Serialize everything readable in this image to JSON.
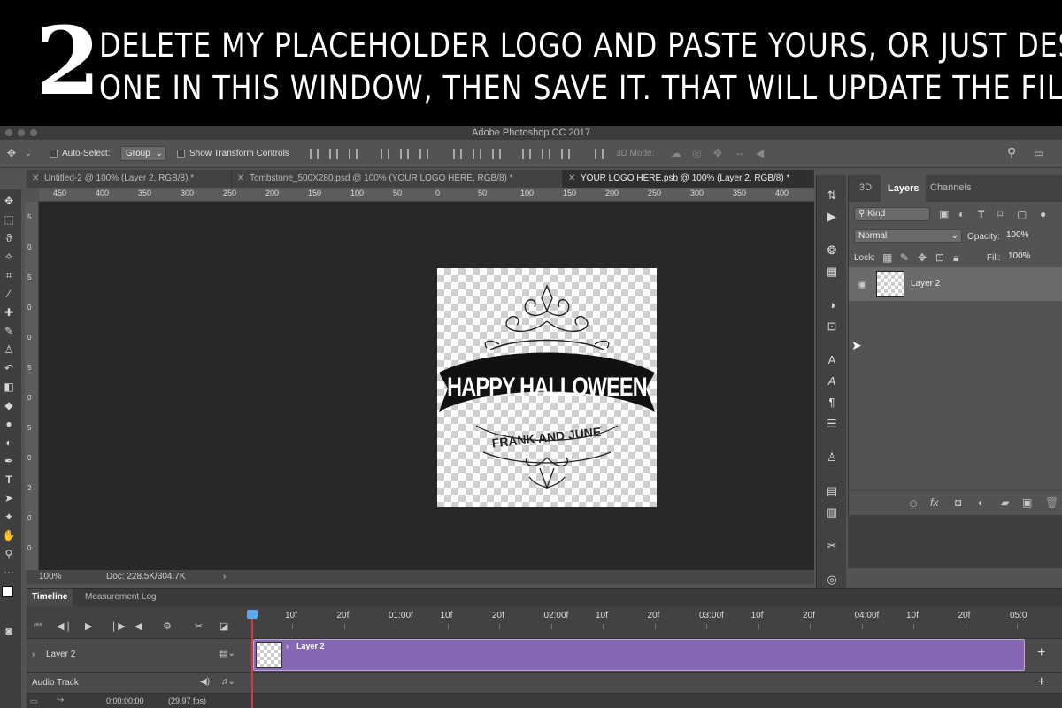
{
  "banner": {
    "number": "2",
    "line1": "DELETE MY PLACEHOLDER LOGO AND PASTE YOURS, OR JUST DESIGN",
    "line2": "ONE IN THIS WINDOW, THEN SAVE IT. THAT WILL UPDATE THE FILE"
  },
  "app": {
    "title": "Adobe Photoshop CC 2017"
  },
  "options": {
    "auto_select_label": "Auto-Select:",
    "auto_select_value": "Group",
    "show_transform_label": "Show Transform Controls",
    "mode_3d_label": "3D Mode:"
  },
  "tabs": [
    {
      "label": "Untitled-2 @ 100% (Layer 2, RGB/8) *"
    },
    {
      "label": "Tombstone_500X280.psd @ 100% (YOUR LOGO HERE, RGB/8) *"
    },
    {
      "label": "YOUR LOGO HERE.psb @ 100% (Layer 2, RGB/8) *"
    }
  ],
  "ruler": {
    "h": [
      "450",
      "400",
      "350",
      "300",
      "250",
      "200",
      "150",
      "100",
      "50",
      "0",
      "50",
      "100",
      "150",
      "200",
      "250",
      "300",
      "350",
      "400"
    ],
    "v": [
      "5",
      "0",
      "5",
      "0",
      "0",
      "5",
      "0",
      "5",
      "0",
      "2",
      "0",
      "0"
    ]
  },
  "logo": {
    "banner_text": "HAPPY HALLOWEEN",
    "sub_text": "FRANK AND JUNE"
  },
  "status": {
    "zoom": "100%",
    "doc": "Doc: 228.5K/304.7K"
  },
  "layers_panel": {
    "tabs": [
      "3D",
      "Layers",
      "Channels"
    ],
    "filter": "Kind",
    "blend_mode": "Normal",
    "opacity_label": "Opacity:",
    "opacity": "100%",
    "lock_label": "Lock:",
    "fill_label": "Fill:",
    "fill": "100%",
    "layer_name": "Layer 2"
  },
  "timeline": {
    "tabs": [
      "Timeline",
      "Measurement Log"
    ],
    "ticks": [
      "10f",
      "20f",
      "01:00f",
      "10f",
      "20f",
      "02:00f",
      "10f",
      "20f",
      "03:00f",
      "10f",
      "20f",
      "04:00f",
      "10f",
      "20f",
      "05:0"
    ],
    "track_layer": "Layer 2",
    "clip_label": "Layer 2",
    "audio_track": "Audio Track",
    "timecode": "0:00:00:00",
    "fps": "(29.97 fps)"
  },
  "colors": {
    "clip": "#8667b3",
    "playhead": "#d23b3b",
    "canvas_bg": "#282828"
  }
}
